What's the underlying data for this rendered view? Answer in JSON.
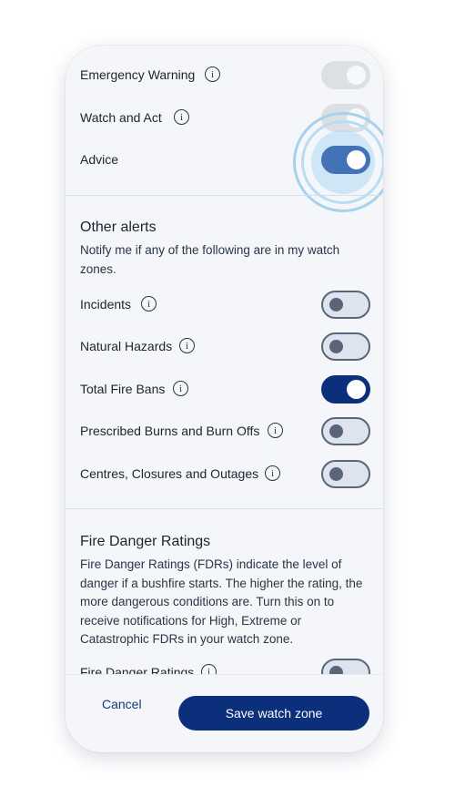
{
  "warning_levels": {
    "items": [
      {
        "label": "Emergency Warning",
        "state": "on-disabled"
      },
      {
        "label": "Watch and Act",
        "state": "on-disabled"
      },
      {
        "label": "Advice",
        "state": "on-active"
      }
    ]
  },
  "other_alerts": {
    "title": "Other alerts",
    "description": "Notify me if any of the following are in my watch zones.",
    "items": [
      {
        "label": "Incidents",
        "state": "off"
      },
      {
        "label": "Natural Hazards",
        "state": "off"
      },
      {
        "label": "Total Fire Bans",
        "state": "on"
      },
      {
        "label": "Prescribed Burns and Burn Offs",
        "state": "off"
      },
      {
        "label": "Centres, Closures and Outages",
        "state": "off"
      }
    ]
  },
  "fire_danger": {
    "title": "Fire Danger Ratings",
    "description": "Fire Danger Ratings (FDRs) indicate the level of danger if a bushfire starts. The higher the rating, the more dangerous conditions are. Turn this on to receive notifications for High, Extreme or Catastrophic FDRs in your watch zone.",
    "items": [
      {
        "label": "Fire Danger Ratings",
        "state": "off"
      }
    ]
  },
  "info_glyph": "i",
  "icons": {
    "info": "info-icon"
  },
  "footer": {
    "cancel_label": "Cancel",
    "save_label": "Save watch zone"
  },
  "colors": {
    "primary": "#0b2f7a",
    "active_toggle": "#4472b6",
    "disabled_toggle": "#dcdfe4",
    "background": "#f4f6fa"
  }
}
